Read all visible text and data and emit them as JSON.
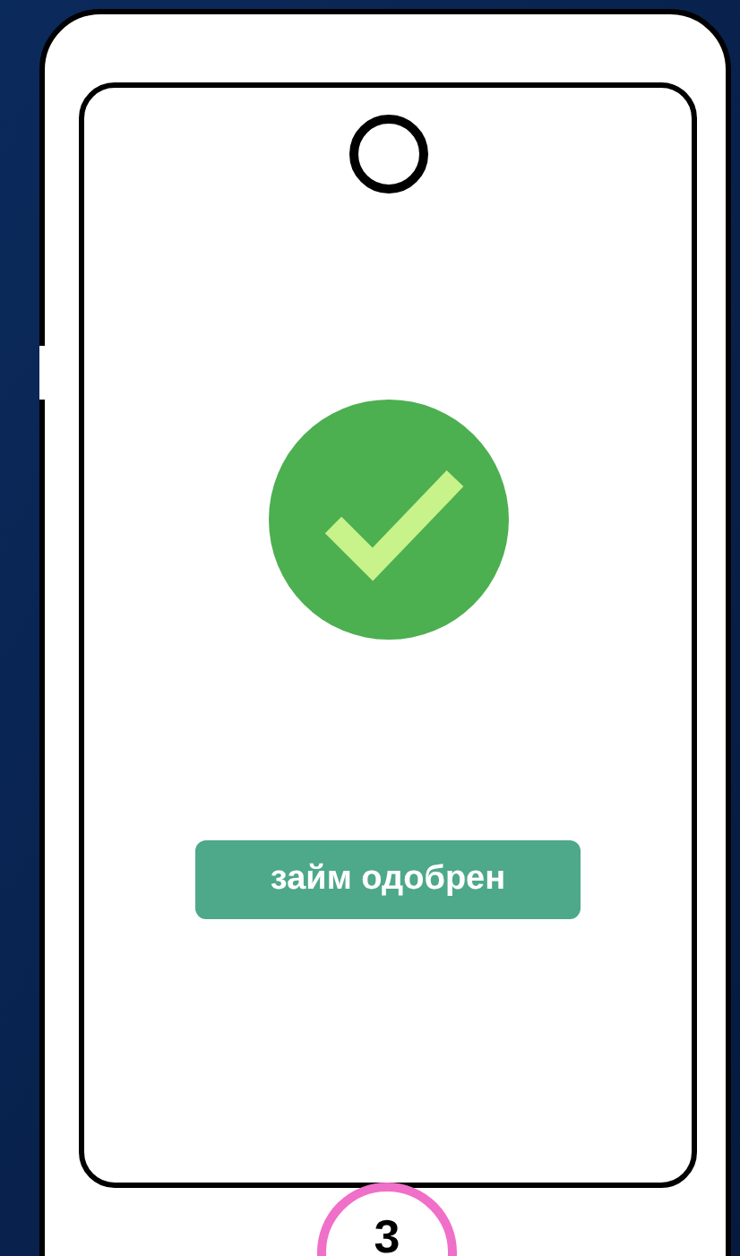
{
  "screen": {
    "approved": true,
    "button": {
      "label": "займ одобрен"
    }
  },
  "step_badge": {
    "label": "3"
  }
}
